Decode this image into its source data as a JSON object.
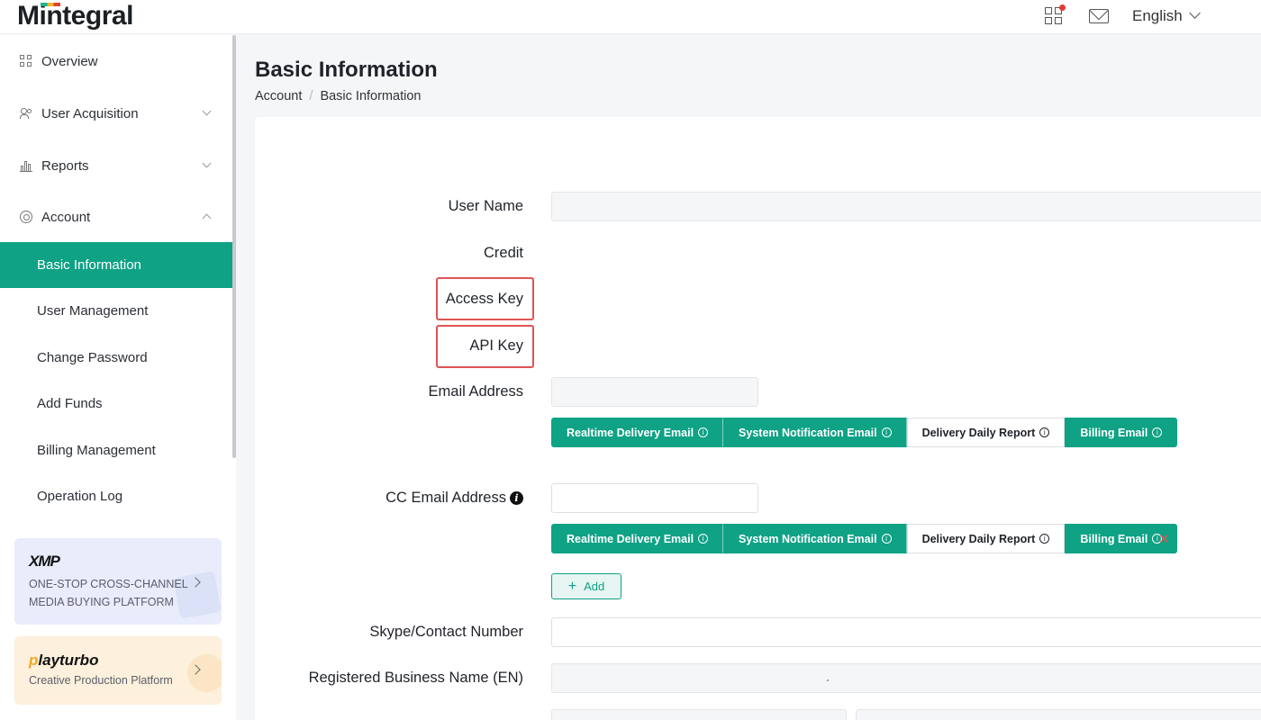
{
  "header": {
    "logo": "Mintegral",
    "language": "English"
  },
  "sidebar": {
    "nav": [
      {
        "label": "Overview",
        "icon": "grid-icon"
      },
      {
        "label": "User Acquisition",
        "icon": "users-icon",
        "chevron": "down"
      },
      {
        "label": "Reports",
        "icon": "chart-icon",
        "chevron": "down"
      },
      {
        "label": "Account",
        "icon": "gear-icon",
        "chevron": "up"
      }
    ],
    "account_items": [
      "Basic Information",
      "User Management",
      "Change Password",
      "Add Funds",
      "Billing Management",
      "Operation Log"
    ],
    "active_item": "Basic Information",
    "promos": {
      "xmp": {
        "brand": "XMP",
        "text": "ONE-STOP CROSS-CHANNEL MEDIA BUYING PLATFORM"
      },
      "playturbo": {
        "brand_accent": "p",
        "brand": "layturbo",
        "text": "Creative Production Platform"
      }
    }
  },
  "page": {
    "title": "Basic Information",
    "breadcrumb": [
      "Account",
      "Basic Information"
    ]
  },
  "form": {
    "user_name_label": "User Name",
    "credit_label": "Credit",
    "access_key_label": "Access Key",
    "api_key_label": "API Key",
    "email_label": "Email Address",
    "cc_email_label": "CC Email Address",
    "skype_label": "Skype/Contact Number",
    "business_name_label": "Registered Business Name (EN)",
    "add_label": "Add",
    "email_tags": [
      {
        "label": "Realtime Delivery Email",
        "selected": true
      },
      {
        "label": "System Notification Email",
        "selected": true
      },
      {
        "label": "Delivery Daily Report",
        "selected": false
      },
      {
        "label": "Billing Email",
        "selected": true
      }
    ],
    "cc_email_tags": [
      {
        "label": "Realtime Delivery Email",
        "selected": true
      },
      {
        "label": "System Notification Email",
        "selected": true
      },
      {
        "label": "Delivery Daily Report",
        "selected": false
      },
      {
        "label": "Billing Email",
        "selected": true
      }
    ],
    "highlight_color": "#e05454"
  },
  "colors": {
    "accent": "#0fa285"
  }
}
